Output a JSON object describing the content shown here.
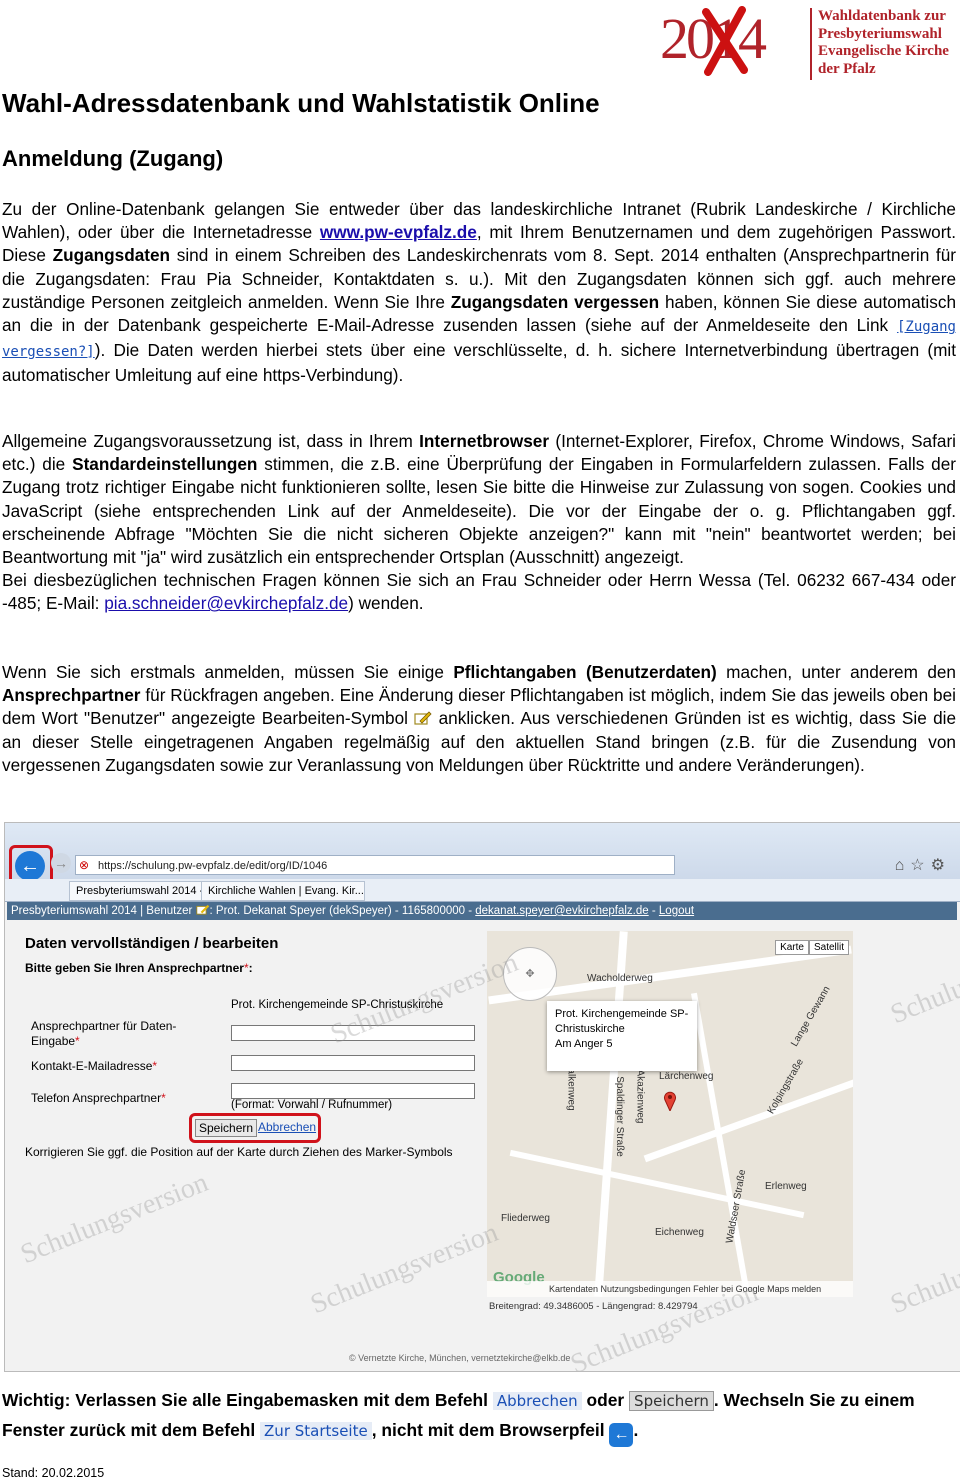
{
  "logo": {
    "year": "2014",
    "lines": [
      "Wahldatenbank zur",
      "Presbyteriumswahl",
      "Evangelische Kirche",
      "der Pfalz"
    ]
  },
  "title": "Wahl-Adressdatenbank und Wahlstatistik Online",
  "subtitle": "Anmeldung (Zugang)",
  "p1": {
    "a": "Zu der Online-Datenbank gelangen Sie entweder über das landeskirchliche Intranet (Rubrik Landeskirche / Kirchliche Wahlen), oder über die Internetadresse ",
    "url": "www.pw-evpfalz.de",
    "b": ", mit Ihrem Benutzernamen und dem zugehörigen Passwort. Diese ",
    "bold1": "Zugangsdaten",
    "c": " sind in einem Schreiben des Landeskirchenrats vom 8. Sept. 2014 enthalten (Ansprechpartnerin für die Zugangsdaten: Frau Pia Schneider, Kontaktdaten s. u.). Mit den Zugangsdaten können sich ggf. auch mehrere zuständige Personen zeitgleich anmelden. Wenn Sie Ihre ",
    "bold2": "Zugangsdaten vergessen",
    "d": " haben, können Sie diese automatisch an die in der Datenbank gespeicherte E-Mail-Adresse zusenden lassen (siehe auf der Anmeldeseite den Link ",
    "forgot_link": "[Zugang vergessen?]",
    "e": "). Die Daten werden hierbei stets über eine verschlüsselte, d. h. sichere Internetverbindung übertragen (mit automatischer Umleitung auf eine https-Verbindung)."
  },
  "p2": {
    "a": "Allgemeine Zugangsvoraussetzung ist, dass in Ihrem ",
    "bold1": "Internetbrowser",
    "b": " (Internet-Explorer, Firefox, Chrome Windows, Safari etc.) die ",
    "bold2": "Standardeinstellungen",
    "c": " stimmen, die z.B. eine Überprüfung der Eingaben in Formularfeldern zulassen. Falls der Zugang trotz richtiger Eingabe nicht funktionieren sollte, lesen Sie bitte die Hinweise zur Zulassung von sogen. Cookies und JavaScript (siehe entsprechenden Link auf der Anmeldeseite). Die vor der Eingabe der o. g. Pflichtangaben ggf. erscheinende Abfrage \"Möchten Sie die nicht sicheren Objekte anzeigen?\" kann mit \"nein\" beantwortet werden; bei Beantwortung mit \"ja\" wird zusätzlich ein entsprechender Ortsplan (Ausschnitt) angezeigt.",
    "d": "Bei diesbezüglichen technischen Fragen können Sie sich an Frau Schneider oder Herrn Wessa (Tel. 06232 667-434 oder -485; E-Mail: ",
    "email": "pia.schneider@evkirchepfalz.de",
    "e": ") wenden."
  },
  "p3": {
    "a": "Wenn Sie sich erstmals anmelden, müssen Sie einige ",
    "bold1": "Pflichtangaben (Benutzerdaten)",
    "b": " machen, unter anderem den ",
    "bold2": "Ansprechpartner",
    "c": " für Rückfragen angeben. Eine Änderung dieser Pflichtangaben ist möglich, indem Sie das jeweils oben bei dem Wort \"Benutzer\" angezeigte Bearbeiten-Symbol ",
    "d": " anklicken. Aus verschiedenen Gründen ist es wichtig, dass Sie die an dieser Stelle eingetragenen Angaben regelmäßig auf den aktuellen Stand bringen (z.B. für die Zusendung von vergessenen Zugangsdaten sowie zur Veranlassung von Meldungen über Rücktritte und andere Veränderungen)."
  },
  "screenshot": {
    "url": "https://schulung.pw-evpfalz.de/edit/org/ID/1046",
    "tab1": "Presbyteriumswahl 2014 - ...",
    "tab2": "Kirchliche Wahlen | Evang. Kir...",
    "appbar_a": "Presbyteriumswahl 2014 | Benutzer ",
    "appbar_b": ": Prot. Dekanat Speyer (dekSpeyer) - 1165800000 - ",
    "appbar_mail": "dekanat.speyer@evkirchepfalz.de",
    "appbar_sep": " - ",
    "appbar_logout": "Logout",
    "form_title": "Daten vervollständigen / bearbeiten",
    "form_hint": "Bitte geben Sie Ihren Ansprechpartner",
    "org_name": "Prot. Kirchengemeinde SP-Christuskirche",
    "label_contact": "Ansprechpartner für Daten-Eingabe",
    "label_email": "Kontakt-E-Mailadresse",
    "label_phone": "Telefon Ansprechpartner",
    "phone_format": "(Format: Vorwahl / Rufnummer)",
    "btn_save": "Speichern",
    "btn_cancel": "Abbrechen",
    "correct_hint": "Korrigieren Sie ggf. die Position auf der Karte durch Ziehen des Marker-Symbols",
    "map_btn_karte": "Karte",
    "map_btn_sat": "Satellit",
    "info_line1": "Prot. Kirchengemeinde SP-",
    "info_line2": "Christuskirche",
    "info_line3": "Am Anger 5",
    "map_footer": "Kartendaten   Nutzungsbedingungen   Fehler bei Google Maps melden",
    "google": "Google",
    "coords": "Breitengrad: 49.3486005 - Längengrad: 8.429794",
    "watermark": "Schulungsversion",
    "footer_credit": "© Vernetzte Kirche, München, vernetztekirche@elkb.de",
    "streets": [
      "Spaldinger Straße",
      "Falkenweg",
      "Akazienweg",
      "Erlenweg",
      "Eichenweg",
      "Waldseer Straße",
      "Fliederweg",
      "Wacholderweg",
      "Lärchenweg",
      "Kolpingstraße",
      "Lange Gewann"
    ]
  },
  "important": {
    "a": "Wichtig: Verlassen Sie alle Eingabemasken mit dem Befehl ",
    "cancel": "Abbrechen",
    "b": " oder ",
    "save": "Speichern",
    "c": ". Wechseln Sie zu einem Fenster zurück mit dem Befehl ",
    "home": "Zur Startseite",
    "d": ", nicht mit dem Browserpfeil ",
    "e": "."
  },
  "footer": "Stand: 20.02.2015",
  "colors": {
    "brand_red": "#b0232a",
    "link_blue": "#1a0dab",
    "highlight_red": "#d0121b"
  }
}
